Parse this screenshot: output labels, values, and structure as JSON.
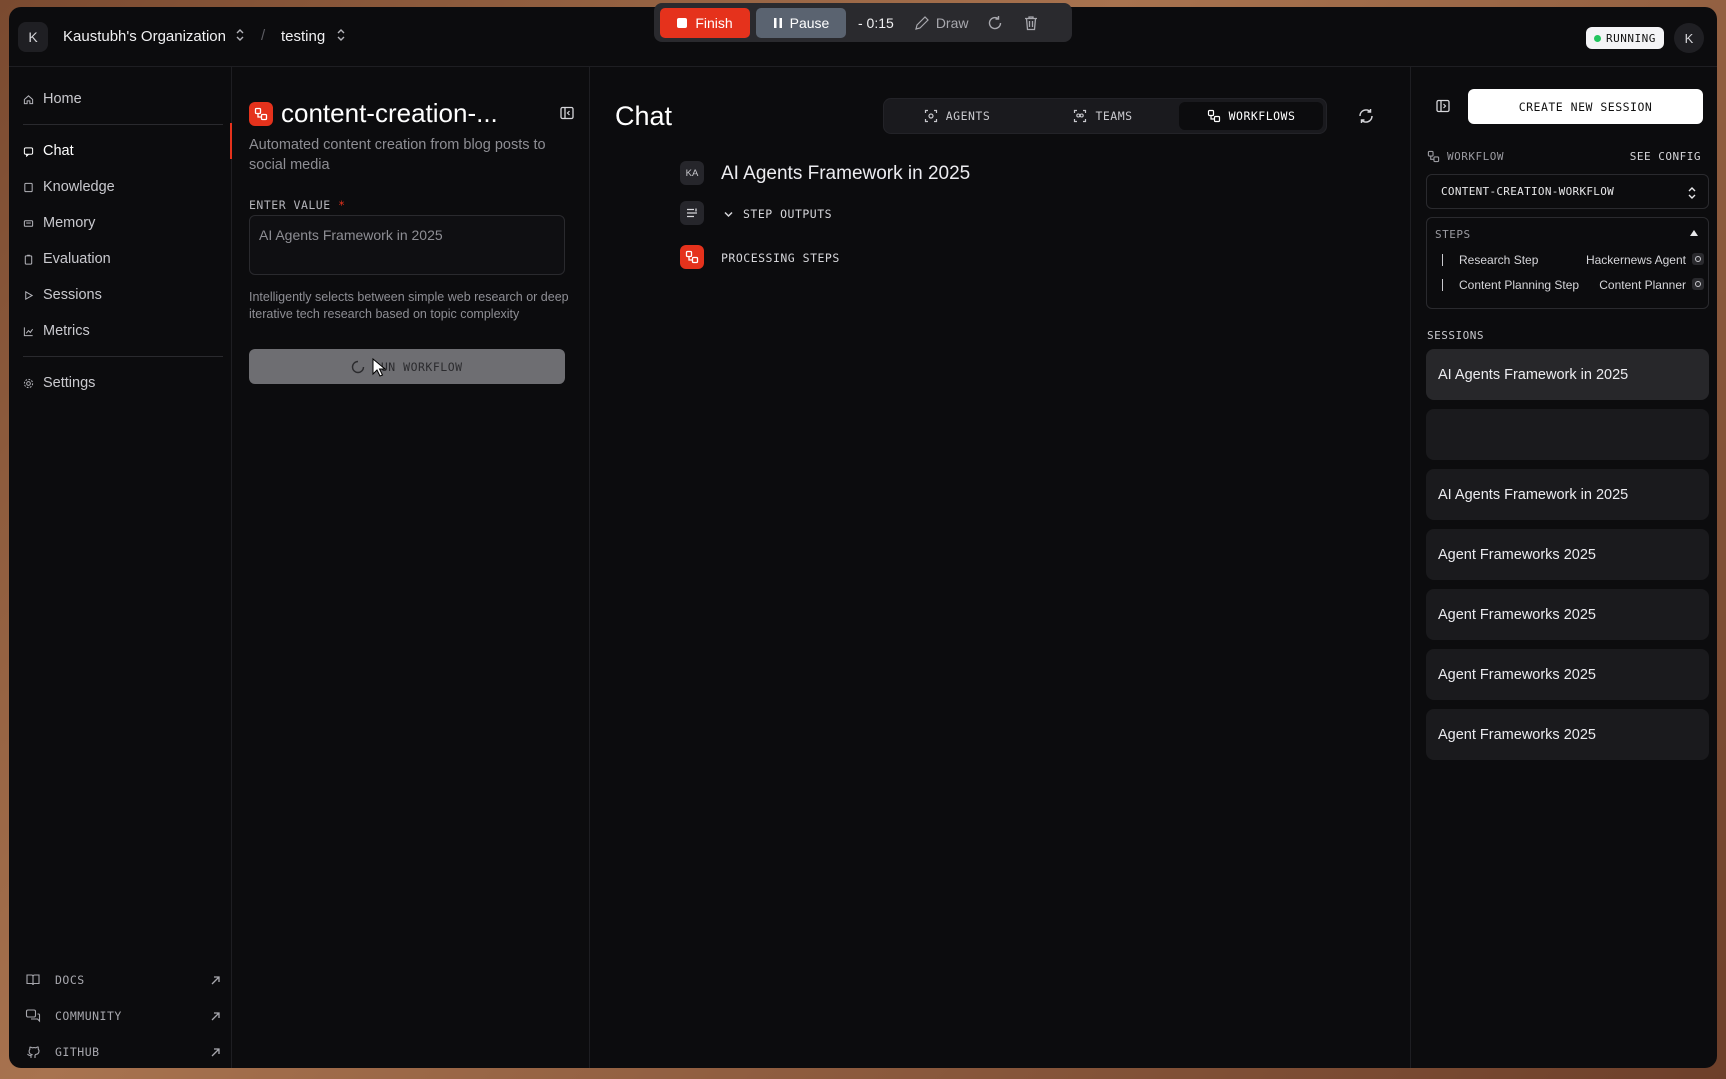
{
  "header": {
    "org_initial": "K",
    "org_name": "Kaustubh's Organization",
    "separator": "/",
    "project_name": "testing",
    "status": "RUNNING",
    "user_initial": "K"
  },
  "recorder": {
    "finish_label": "Finish",
    "pause_label": "Pause",
    "timer": "- 0:15",
    "draw_label": "Draw"
  },
  "nav": {
    "items": [
      {
        "label": "Home",
        "icon": "home-icon"
      },
      {
        "label": "Chat",
        "icon": "chat-icon"
      },
      {
        "label": "Knowledge",
        "icon": "book-icon"
      },
      {
        "label": "Memory",
        "icon": "memory-icon"
      },
      {
        "label": "Evaluation",
        "icon": "clipboard-icon"
      },
      {
        "label": "Sessions",
        "icon": "play-icon"
      },
      {
        "label": "Metrics",
        "icon": "chart-icon"
      },
      {
        "label": "Settings",
        "icon": "gear-icon"
      }
    ],
    "active": "Chat",
    "footer": [
      {
        "label": "DOCS"
      },
      {
        "label": "COMMUNITY"
      },
      {
        "label": "GITHUB"
      }
    ]
  },
  "workflow_panel": {
    "title": "content-creation-...",
    "description": "Automated content creation from blog posts to social media",
    "input_label": "ENTER VALUE",
    "required_mark": "*",
    "input_value": "AI Agents Framework in 2025",
    "help_text": "Intelligently selects between simple web research or deep iterative tech research based on topic complexity",
    "run_label": "RUN WORKFLOW"
  },
  "chat": {
    "title": "Chat",
    "tabs": [
      {
        "label": "AGENTS"
      },
      {
        "label": "TEAMS"
      },
      {
        "label": "WORKFLOWS"
      }
    ],
    "active_tab": "WORKFLOWS",
    "message_avatar": "KA",
    "message_text": "AI Agents Framework in 2025",
    "step_outputs_label": "STEP OUTPUTS",
    "processing_label": "PROCESSING STEPS"
  },
  "right_panel": {
    "new_session_label": "CREATE NEW SESSION",
    "workflow_label": "WORKFLOW",
    "see_config_label": "SEE CONFIG",
    "selected_workflow": "CONTENT-CREATION-WORKFLOW",
    "steps_label": "STEPS",
    "steps": [
      {
        "name": "Research Step",
        "agent": "Hackernews Agent"
      },
      {
        "name": "Content Planning Step",
        "agent": "Content Planner"
      }
    ],
    "sessions_label": "SESSIONS",
    "sessions": [
      {
        "title": "AI Agents Framework in 2025"
      },
      {
        "title": ""
      },
      {
        "title": "AI Agents Framework in 2025"
      },
      {
        "title": "Agent Frameworks 2025"
      },
      {
        "title": "Agent Frameworks 2025"
      },
      {
        "title": "Agent Frameworks 2025"
      },
      {
        "title": "Agent Frameworks 2025"
      }
    ]
  },
  "colors": {
    "accent": "#e5321c",
    "background": "#0c0c0e",
    "running_dot": "#22c55e"
  }
}
